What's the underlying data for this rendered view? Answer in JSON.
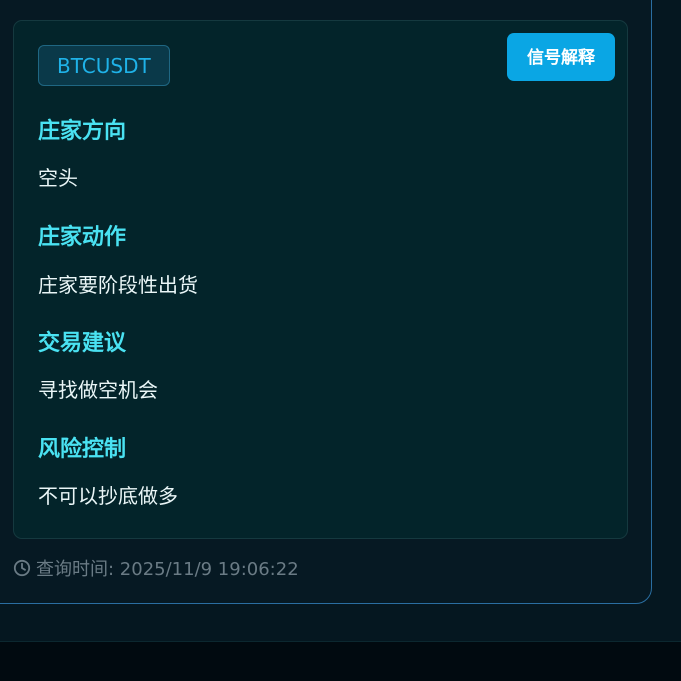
{
  "signal": {
    "symbol": "BTCUSDT",
    "explain_button": "信号解释",
    "sections": [
      {
        "title": "庄家方向",
        "text": "空头"
      },
      {
        "title": "庄家动作",
        "text": "庄家要阶段性出货"
      },
      {
        "title": "交易建议",
        "text": "寻找做空机会"
      },
      {
        "title": "风险控制",
        "text": "不可以抄底做多"
      }
    ]
  },
  "footer": {
    "query_time": "查询时间: 2025/11/9 19:06:22",
    "icon": "clock-icon"
  },
  "colors": {
    "accent": "#0aa6e4",
    "title": "#4ae2f2",
    "text": "#eaf6f7",
    "muted": "#6a7b85",
    "border": "#2a6ea1"
  }
}
